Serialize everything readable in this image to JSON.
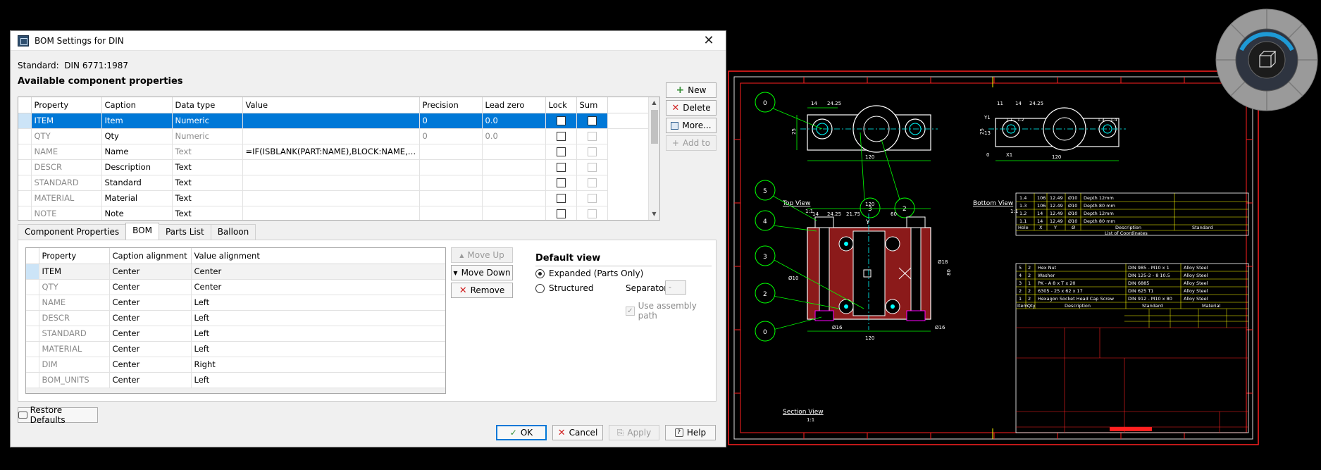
{
  "dialog": {
    "title": "BOM Settings for DIN",
    "standard_label": "Standard:",
    "standard_value": "DIN 6771:1987",
    "section_title": "Available component properties"
  },
  "props_table": {
    "headers": [
      "Property",
      "Caption",
      "Data type",
      "Value",
      "Precision",
      "Lead zero",
      "Lock",
      "Sum"
    ],
    "rows": [
      {
        "property": "ITEM",
        "caption": "Item",
        "datatype": "Numeric",
        "value": "",
        "precision": "0",
        "leadzero": "0.0"
      },
      {
        "property": "QTY",
        "caption": "Qty",
        "datatype": "Numeric",
        "value": "",
        "precision": "0",
        "leadzero": "0.0"
      },
      {
        "property": "NAME",
        "caption": "Name",
        "datatype": "Text",
        "value": "=IF(ISBLANK(PART:NAME),BLOCK:NAME,PAR...",
        "precision": "",
        "leadzero": ""
      },
      {
        "property": "DESCR",
        "caption": "Description",
        "datatype": "Text",
        "value": "",
        "precision": "",
        "leadzero": ""
      },
      {
        "property": "STANDARD",
        "caption": "Standard",
        "datatype": "Text",
        "value": "",
        "precision": "",
        "leadzero": ""
      },
      {
        "property": "MATERIAL",
        "caption": "Material",
        "datatype": "Text",
        "value": "",
        "precision": "",
        "leadzero": ""
      },
      {
        "property": "NOTE",
        "caption": "Note",
        "datatype": "Text",
        "value": "",
        "precision": "",
        "leadzero": ""
      }
    ]
  },
  "side_buttons": {
    "new": "New",
    "delete": "Delete",
    "more": "More...",
    "add_to": "Add to"
  },
  "tabs": [
    "Component Properties",
    "BOM",
    "Parts List",
    "Balloon"
  ],
  "bom_table": {
    "headers": [
      "Property",
      "Caption alignment",
      "Value alignment"
    ],
    "rows": [
      {
        "property": "ITEM",
        "caption": "Center",
        "value": "Center"
      },
      {
        "property": "QTY",
        "caption": "Center",
        "value": "Center"
      },
      {
        "property": "NAME",
        "caption": "Center",
        "value": "Left"
      },
      {
        "property": "DESCR",
        "caption": "Center",
        "value": "Left"
      },
      {
        "property": "STANDARD",
        "caption": "Center",
        "value": "Left"
      },
      {
        "property": "MATERIAL",
        "caption": "Center",
        "value": "Left"
      },
      {
        "property": "DIM",
        "caption": "Center",
        "value": "Right"
      },
      {
        "property": "BOM_UNITS",
        "caption": "Center",
        "value": "Left"
      }
    ]
  },
  "panel_buttons": {
    "move_up": "Move Up",
    "move_down": "Move Down",
    "remove": "Remove"
  },
  "default_view": {
    "title": "Default view",
    "expanded": "Expanded (Parts Only)",
    "structured": "Structured",
    "separator_label": "Separator",
    "separator_value": "-",
    "use_assembly": "Use assembly path"
  },
  "bottom": {
    "restore": "Restore Defaults",
    "ok": "OK",
    "cancel": "Cancel",
    "apply": "Apply",
    "help": "Help"
  },
  "drawing": {
    "top_view": "Top View",
    "bottom_view": "Bottom View",
    "section_view": "Section View",
    "scale": "1:1",
    "coords_title": "List of Coordinates",
    "coords_headers": [
      "Hole",
      "X",
      "Y",
      "Ø",
      "Description",
      "Standard"
    ],
    "coords_rows": [
      [
        "1.4",
        "106",
        "12.49",
        "Ø10",
        "Depth 12mm",
        ""
      ],
      [
        "1.3",
        "106",
        "12.49",
        "Ø10",
        "Depth 80 mm",
        ""
      ],
      [
        "1.2",
        "14",
        "12.49",
        "Ø10",
        "Depth 12mm",
        ""
      ],
      [
        "1.1",
        "14",
        "12.49",
        "Ø10",
        "Depth 80 mm",
        ""
      ]
    ],
    "bom_headers": [
      "Item",
      "Qty",
      "Description",
      "Standard",
      "Material"
    ],
    "bom_rows": [
      [
        "5",
        "2",
        "Hex Nut",
        "DIN 985 - M10 x 1",
        "Alloy Steel"
      ],
      [
        "4",
        "2",
        "Washer",
        "DIN 125-2 - 8 10.5",
        "Alloy Steel"
      ],
      [
        "3",
        "1",
        "PK - A 8 x T x 20",
        "DIN 6885",
        "Alloy Steel"
      ],
      [
        "2",
        "2",
        "6305 - 25 x 62 x 17",
        "DIN 625 T1",
        "Alloy Steel"
      ],
      [
        "1",
        "2",
        "Hexagon Socket Head Cap Screw",
        "DIN 912 - M10 x 80",
        "Alloy Steel"
      ]
    ],
    "balloons_top": [
      "0",
      "3",
      "2"
    ],
    "balloons_section": [
      "5",
      "4",
      "3",
      "2",
      "0"
    ],
    "dims": {
      "d1": "14",
      "d2": "24.25",
      "d3": "120",
      "d4": "25",
      "d5": "11",
      "d6": "13",
      "d7": "Y1",
      "d8": "X1",
      "d9": "21.75",
      "d10": "60",
      "d11": "Ø10",
      "d12": "Ø16",
      "d13": "Ø16",
      "d14": "Ø18",
      "d15": "80",
      "d16": "Y",
      "d17": "1.1",
      "d18": "1.2",
      "d19": "1.3",
      "d20": "1.4",
      "d21": "0"
    }
  }
}
